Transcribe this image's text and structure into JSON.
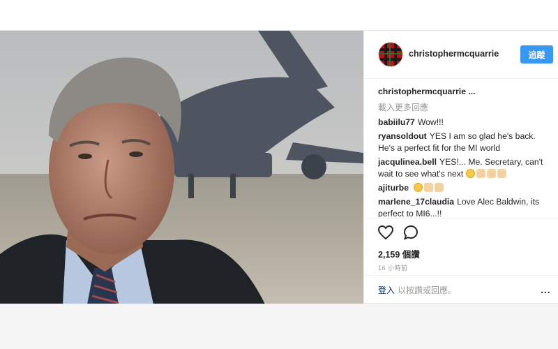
{
  "header": {
    "username": "christophermcquarrie",
    "follow_label": "追蹤"
  },
  "caption": {
    "username": "christophermcquarrie ..."
  },
  "load_more_label": "載入更多回應",
  "comments": [
    {
      "user": "babiilu77",
      "text": "Wow!!!"
    },
    {
      "user": "ryansoldout",
      "text": "YES I am so glad he's back. He's a perfect fit for the MI world"
    },
    {
      "user": "jacqulinea.bell",
      "text": "YES!... Me. Secretary, can't wait to see what's next"
    },
    {
      "user": "ajiturbe",
      "text": ""
    },
    {
      "user": "marlene_17claudia",
      "text": "Love Alec Baldwin, its perfect to MI6...!!"
    }
  ],
  "likes": "2,159 個讚",
  "timestamp": "16 小時前",
  "footer": {
    "login_label": "登入",
    "login_suffix": "以按讚或回應。",
    "more_label": "..."
  },
  "colors": {
    "follow_button": "#3897f0",
    "link": "#003569",
    "muted": "#999999"
  },
  "icons": {
    "heart": "heart-icon",
    "comment": "comment-icon",
    "more": "more-options-icon"
  }
}
